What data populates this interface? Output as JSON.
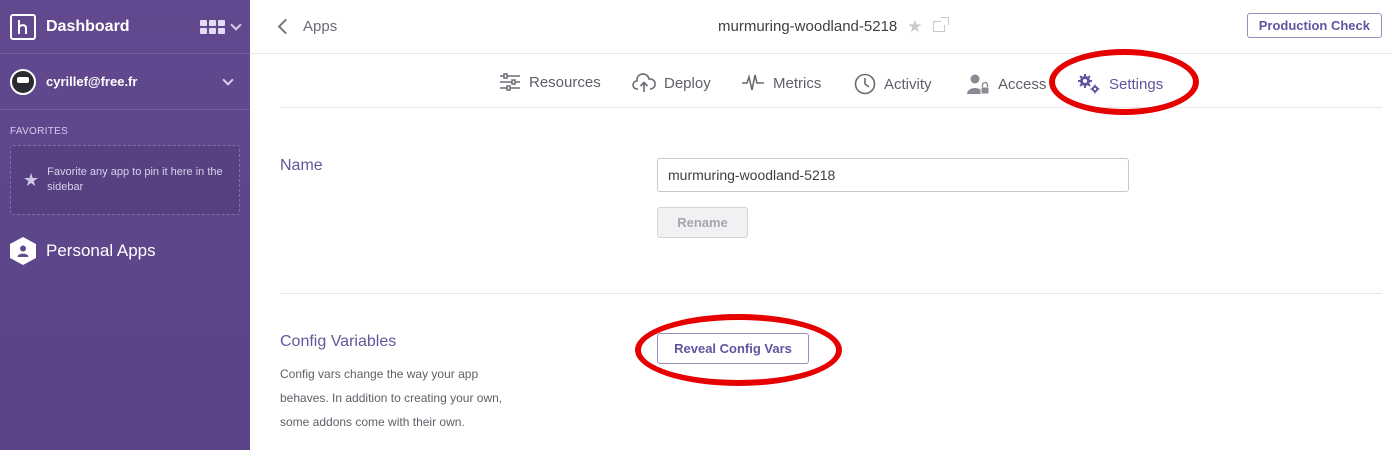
{
  "sidebar": {
    "title": "Dashboard",
    "user_email": "cyrillef@free.fr",
    "favorites_heading": "FAVORITES",
    "favorites_hint": "Favorite any app to pin it here in the sidebar",
    "personal_apps": "Personal Apps"
  },
  "header": {
    "back_label": "Apps",
    "app_name": "murmuring-woodland-5218",
    "production_check": "Production Check"
  },
  "tabs": [
    {
      "label": "Resources",
      "icon": "sliders-icon"
    },
    {
      "label": "Deploy",
      "icon": "cloud-upload-icon"
    },
    {
      "label": "Metrics",
      "icon": "pulse-icon"
    },
    {
      "label": "Activity",
      "icon": "clock-icon"
    },
    {
      "label": "Access",
      "icon": "user-lock-icon"
    },
    {
      "label": "Settings",
      "icon": "gears-icon",
      "active": true
    }
  ],
  "name_section": {
    "label": "Name",
    "value": "murmuring-woodland-5218",
    "rename_button": "Rename"
  },
  "config_section": {
    "label": "Config Variables",
    "description": "Config vars change the way your app behaves. In addition to creating your own, some addons come with their own.",
    "reveal_button": "Reveal Config Vars"
  },
  "colors": {
    "sidebar": "#5f4b8b",
    "accent": "#6353a0",
    "annotation": "#e60000"
  }
}
